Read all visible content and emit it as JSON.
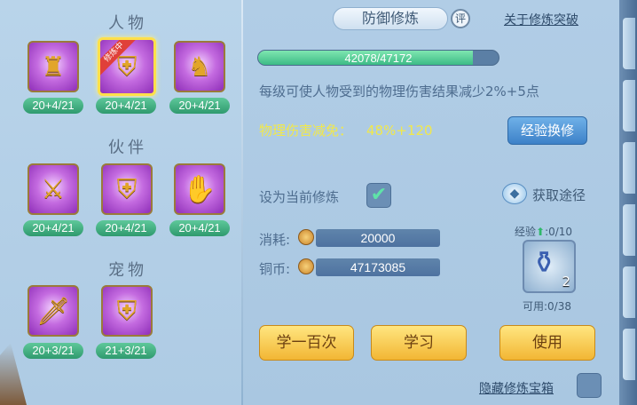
{
  "left": {
    "sections": [
      {
        "title": "人物",
        "items": [
          {
            "icon": "character-armor-icon",
            "level": "20+4/21",
            "selected": false
          },
          {
            "icon": "character-defense-icon",
            "level": "20+4/21",
            "selected": true,
            "ribbon": "修炼中"
          },
          {
            "icon": "character-body-icon",
            "level": "20+4/21",
            "selected": false
          }
        ]
      },
      {
        "title": "伙伴",
        "items": [
          {
            "icon": "partner-attack-icon",
            "level": "20+4/21"
          },
          {
            "icon": "partner-defense-icon",
            "level": "20+4/21"
          },
          {
            "icon": "partner-magic-icon",
            "level": "20+4/21"
          }
        ]
      },
      {
        "title": "宠物",
        "items": [
          {
            "icon": "pet-attack-icon",
            "level": "20+3/21"
          },
          {
            "icon": "pet-defense-icon",
            "level": "21+3/21"
          }
        ]
      }
    ]
  },
  "main": {
    "title": "防御修炼",
    "rate_label": "评",
    "breakthrough_link": "关于修炼突破",
    "progress": {
      "current": 42078,
      "max": 47172,
      "text": "42078/47172",
      "fraction": 0.892
    },
    "description": "每级可使人物受到的物理伤害结果减少2%+5点",
    "reduction_label": "物理伤害减免：",
    "reduction_value": "48%+120",
    "exp_convert_button": "经验换修",
    "set_current_label": "设为当前修炼",
    "set_current_checked": "✔",
    "obtain_label": "获取途径",
    "cost_label": "消耗:",
    "cost_value": "20000",
    "coins_label": "铜币:",
    "coins_value": "47173085",
    "exp_label": "经验",
    "exp_value": ":0/10",
    "potion_count": "2",
    "usable_label": "可用:0/38",
    "buttons": {
      "learn_hundred": "学一百次",
      "learn": "学习",
      "use": "使用"
    },
    "hide_chest_label": "隐藏修炼宝箱"
  },
  "colors": {
    "accent_green": "#3dbb86",
    "button_yellow": "#f2b634",
    "button_blue": "#3d81c8",
    "highlight_text": "#f1e84a"
  }
}
